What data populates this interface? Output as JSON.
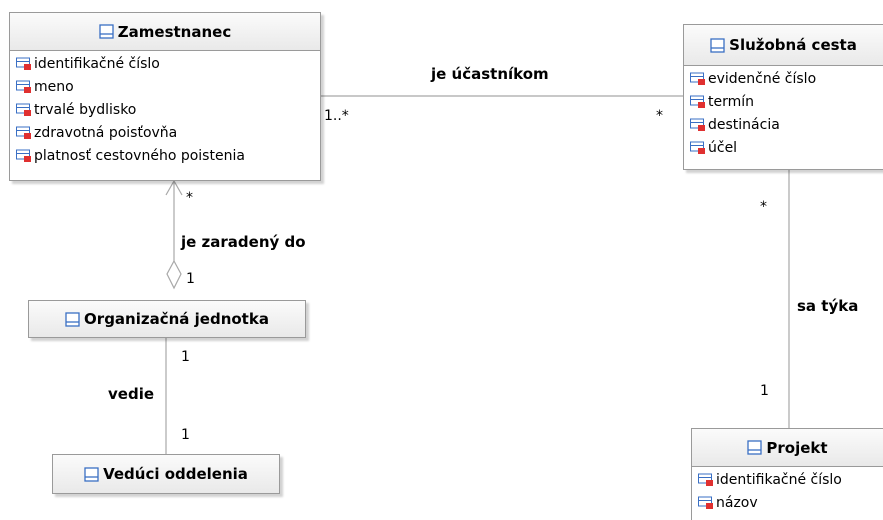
{
  "classes": {
    "zamestnanec": {
      "name": "Zamestnanec",
      "attributes": [
        "identifikačné číslo",
        "meno",
        "trvalé bydlisko",
        "zdravotná poisťovňa",
        "platnosť cestovného poistenia"
      ]
    },
    "sluzobna_cesta": {
      "name": "Služobná cesta",
      "attributes": [
        "evidenčné číslo",
        "termín",
        "destinácia",
        "účel"
      ]
    },
    "organizacna_jednotka": {
      "name": "Organizačná jednotka"
    },
    "veduci_oddelenia": {
      "name": "Vedúci oddelenia"
    },
    "projekt": {
      "name": "Projekt",
      "attributes": [
        "identifikačné číslo",
        "názov"
      ]
    }
  },
  "associations": {
    "ucastnikom": {
      "label": "je účastníkom",
      "mult_zamestnanec": "1..*",
      "mult_cesta": "*"
    },
    "zaradeny": {
      "label": "je zaradený do",
      "mult_zamestnanec": "*",
      "mult_jednotka": "1"
    },
    "vedie": {
      "label": "vedie",
      "mult_jednotka": "1",
      "mult_veduci": "1"
    },
    "tyka": {
      "label": "sa týka",
      "mult_cesta": "*",
      "mult_projekt": "1"
    }
  },
  "colors": {
    "class_icon": "#3a6fc4",
    "attr_icon_blue": "#3a6fc4",
    "attr_icon_red": "#e03030",
    "line": "#a8a8a8",
    "border": "#9a9a9a"
  }
}
